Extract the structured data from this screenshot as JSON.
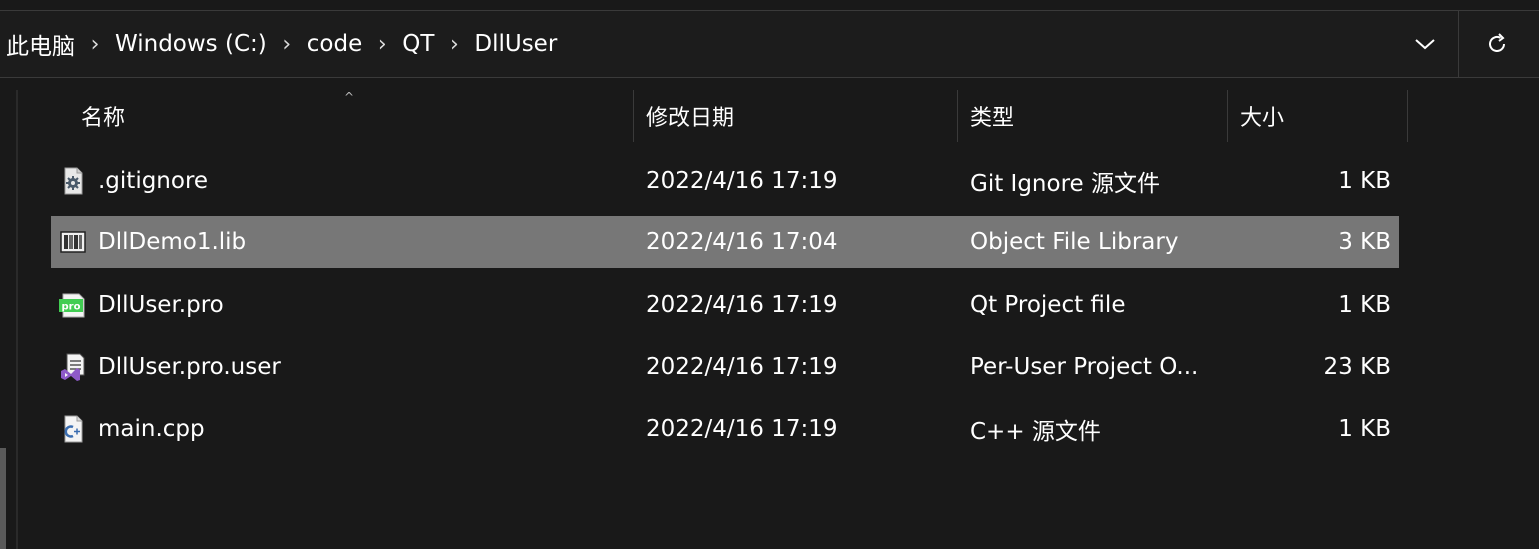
{
  "breadcrumb": {
    "items": [
      "此电脑",
      "Windows (C:)",
      "code",
      "QT",
      "DllUser"
    ],
    "separator": "›"
  },
  "icons": {
    "dropdown": "chevron-down-icon",
    "refresh": "refresh-icon",
    "sort": "sort-up-arrow-icon"
  },
  "columns": {
    "name": "名称",
    "modified": "修改日期",
    "type": "类型",
    "size": "大小"
  },
  "files": [
    {
      "name": ".gitignore",
      "modified": "2022/4/16 17:19",
      "type": "Git Ignore 源文件",
      "size": "1 KB",
      "icon": "gear-file-icon",
      "selected": false
    },
    {
      "name": "DllDemo1.lib",
      "modified": "2022/4/16 17:04",
      "type": "Object File Library",
      "size": "3 KB",
      "icon": "library-file-icon",
      "selected": true
    },
    {
      "name": "DllUser.pro",
      "modified": "2022/4/16 17:19",
      "type": "Qt Project file",
      "size": "1 KB",
      "icon": "qt-pro-file-icon",
      "selected": false
    },
    {
      "name": "DllUser.pro.user",
      "modified": "2022/4/16 17:19",
      "type": "Per-User Project O...",
      "size": "23 KB",
      "icon": "visual-studio-file-icon",
      "selected": false
    },
    {
      "name": "main.cpp",
      "modified": "2022/4/16 17:19",
      "type": "C++ 源文件",
      "size": "1 KB",
      "icon": "cpp-file-icon",
      "selected": false
    }
  ],
  "colors": {
    "background": "#191919",
    "selection": "#777777",
    "divider": "#3a3a3a"
  }
}
